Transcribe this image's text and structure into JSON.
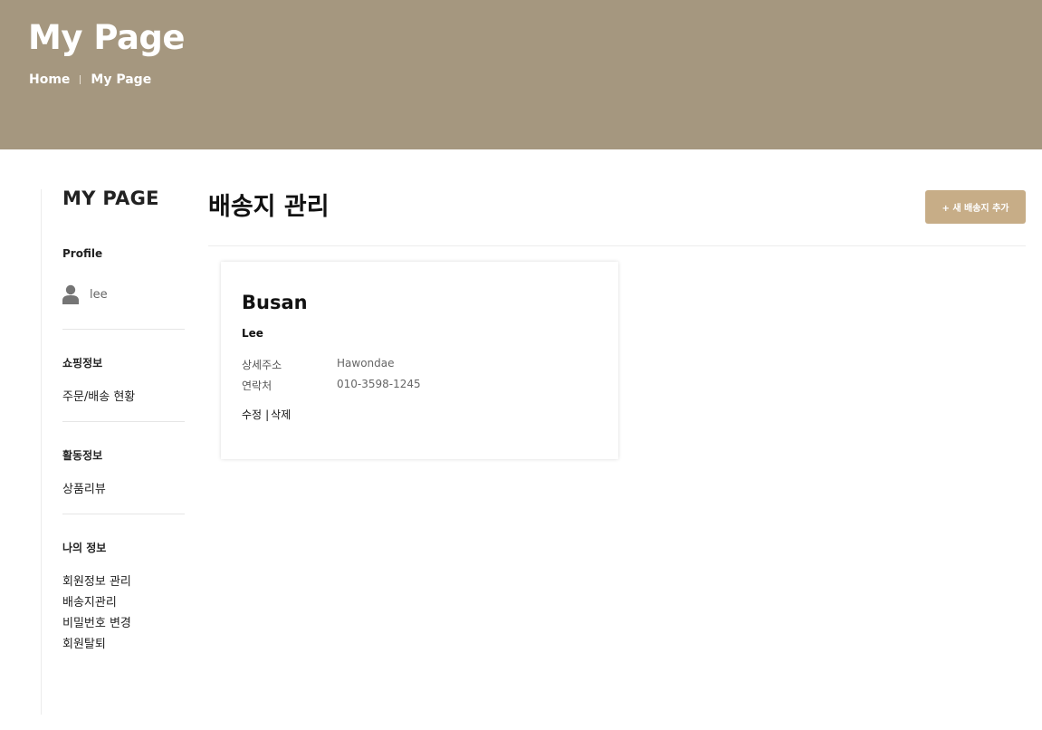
{
  "hero": {
    "title": "My Page",
    "breadcrumb": [
      "Home",
      "My Page"
    ]
  },
  "sidebar": {
    "title": "MY PAGE",
    "profile": {
      "heading": "Profile",
      "username": "lee"
    },
    "sections": [
      {
        "heading": "쇼핑정보",
        "links": [
          "주문/배송 현황"
        ]
      },
      {
        "heading": "활동정보",
        "links": [
          "상품리뷰"
        ]
      },
      {
        "heading": "나의 정보",
        "links": [
          "회원정보 관리",
          "배송지관리",
          "비밀번호 변경",
          "회원탈퇴"
        ]
      }
    ]
  },
  "main": {
    "title": "배송지 관리",
    "add_button": "+ 새 배송지 추가",
    "addresses": [
      {
        "city": "Busan",
        "name": "Lee",
        "fields": [
          {
            "label": "상세주소",
            "value": "Hawondae"
          },
          {
            "label": "연락처",
            "value": "010-3598-1245"
          }
        ],
        "actions": {
          "edit": "수정",
          "separator": "|",
          "delete": "삭제"
        }
      }
    ]
  },
  "colors": {
    "hero_bg": "#a5977f",
    "button_bg": "#c7ad87",
    "text_dark": "#222222"
  },
  "icons": {
    "profile": "user-icon"
  }
}
